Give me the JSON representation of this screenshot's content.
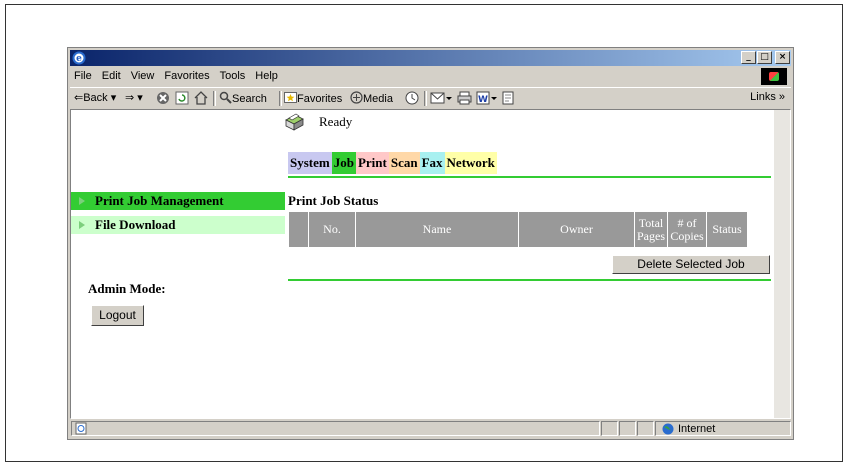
{
  "menubar": {
    "items": [
      "File",
      "Edit",
      "View",
      "Favorites",
      "Tools",
      "Help"
    ]
  },
  "toolbar": {
    "back_label": "⇐Back ▾",
    "forward_label": "⇒ ▾",
    "search_label": "Search",
    "favorites_label": "Favorites",
    "media_label": "Media",
    "links_label": "Links »"
  },
  "printer": {
    "status": "Ready"
  },
  "tabs": [
    {
      "label": "System",
      "color": "#c8c8f0"
    },
    {
      "label": "Job",
      "color": "#33cc33"
    },
    {
      "label": "Print",
      "color": "#ffc8c8"
    },
    {
      "label": "Scan",
      "color": "#ffd8a8"
    },
    {
      "label": "Fax",
      "color": "#a8f0f0"
    },
    {
      "label": "Network",
      "color": "#ffffa8"
    }
  ],
  "sidebar": {
    "items": [
      {
        "label": "Print Job Management",
        "color": "#33cc33"
      },
      {
        "label": "File Download",
        "color": "#ccffcc"
      }
    ],
    "admin_label": "Admin Mode:",
    "logout_label": "Logout"
  },
  "main": {
    "section_title": "Print Job Status",
    "columns": [
      "No.",
      "Name",
      "Owner",
      "Total Pages",
      "# of Copies",
      "Status"
    ],
    "delete_button": "Delete Selected Job"
  },
  "statusbar": {
    "zone": "Internet"
  }
}
